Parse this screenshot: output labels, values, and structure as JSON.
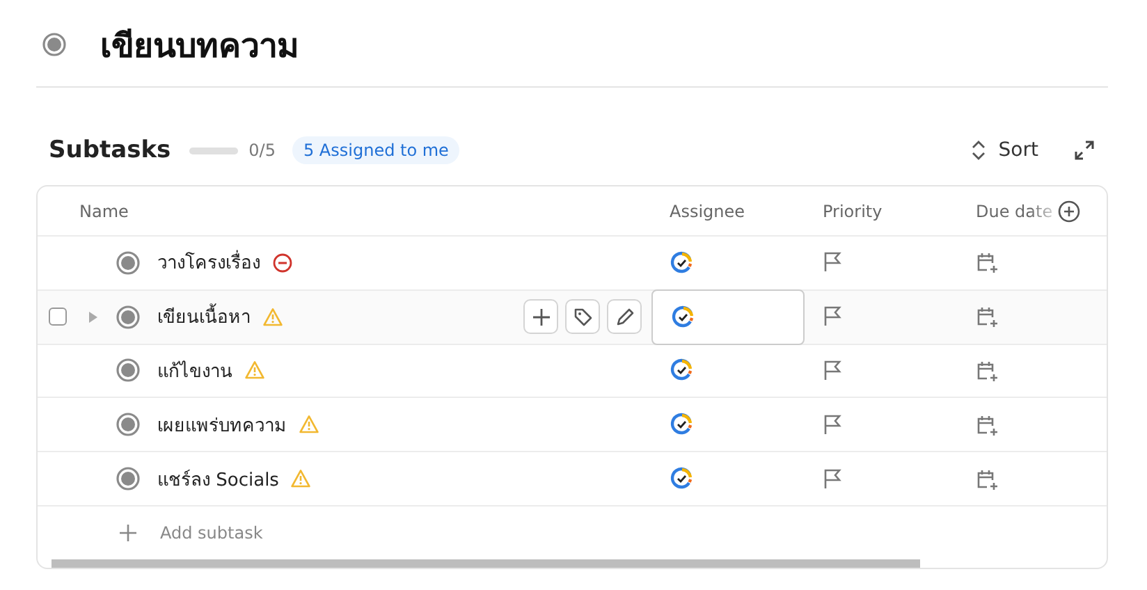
{
  "task": {
    "title": "เขียนบทความ"
  },
  "subtasks": {
    "heading": "Subtasks",
    "progress": {
      "level": 0,
      "reading": "0/5"
    },
    "badge": "5 Assigned to me",
    "sort_label": "Sort",
    "columns": [
      "Name",
      "Assignee",
      "Priority",
      "Due date"
    ],
    "rows": [
      {
        "name": "วางโครงเรื่อง",
        "kind": "blocked",
        "hovered": false
      },
      {
        "name": "เขียนเนื้อหา",
        "kind": "warning",
        "hovered": true
      },
      {
        "name": "แก้ไขงาน",
        "kind": "warning",
        "hovered": false
      },
      {
        "name": "เผยแพร่บทความ",
        "kind": "warning",
        "hovered": false
      },
      {
        "name": "แชร์ลง Socials",
        "kind": "warning",
        "hovered": false
      }
    ],
    "add_label": "Add subtask"
  }
}
